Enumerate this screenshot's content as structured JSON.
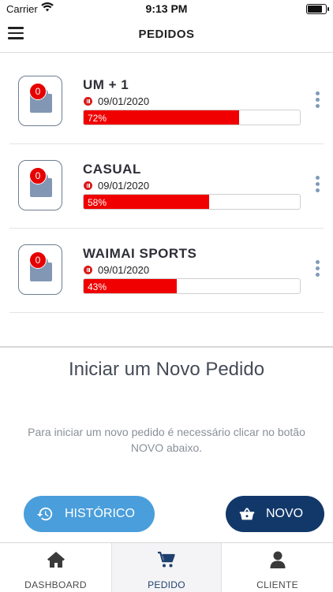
{
  "status_bar": {
    "carrier": "Carrier",
    "time": "9:13 PM"
  },
  "header": {
    "title": "PEDIDOS"
  },
  "orders": [
    {
      "name": "UM +  1",
      "date": "09/01/2020",
      "badge": "0",
      "progress": 0.72,
      "progress_label": "72%"
    },
    {
      "name": "CASUAL",
      "date": "09/01/2020",
      "badge": "0",
      "progress": 0.58,
      "progress_label": "58%"
    },
    {
      "name": "WAIMAI SPORTS",
      "date": "09/01/2020",
      "badge": "0",
      "progress": 0.43,
      "progress_label": "43%"
    }
  ],
  "new_order": {
    "title": "Iniciar um Novo Pedido",
    "description": "Para iniciar um novo pedido é necessário clicar no botão NOVO abaixo."
  },
  "buttons": {
    "historico": {
      "label": "HISTÓRICO",
      "icon": "history-icon"
    },
    "novo": {
      "label": "NOVO",
      "icon": "basket-icon"
    }
  },
  "tabs": [
    {
      "label": "DASHBOARD",
      "icon": "home-icon"
    },
    {
      "label": "PEDIDO",
      "icon": "cart-icon",
      "active": true
    },
    {
      "label": "CLIENTE",
      "icon": "user-icon"
    }
  ],
  "colors": {
    "progress": "#f00000",
    "badge": "#e60000",
    "historico_button": "#4a9edb",
    "novo_button": "#12386a"
  }
}
